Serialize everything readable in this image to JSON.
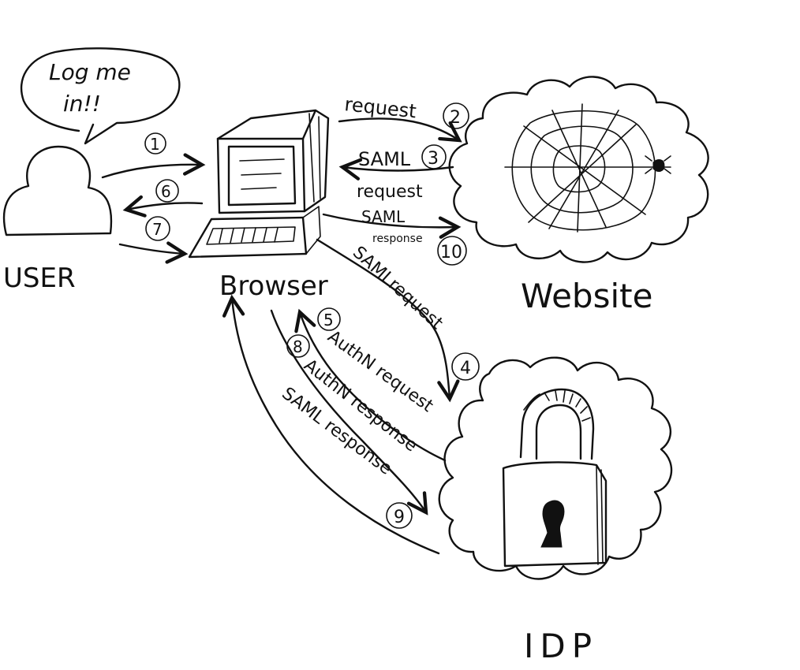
{
  "actors": {
    "user": {
      "label": "USER",
      "speech": [
        "Log me",
        "in!!"
      ]
    },
    "browser": {
      "label": "Browser"
    },
    "website": {
      "label": "Website"
    },
    "idp": {
      "label": "IDP"
    }
  },
  "flows": {
    "user_to_browser": {
      "step": "1"
    },
    "browser_to_user": {
      "step": "6"
    },
    "user_to_browser_2": {
      "step": "7"
    },
    "request": {
      "step": "2",
      "label": "request"
    },
    "saml_request": {
      "step": "3",
      "label_top": "SAML",
      "label_bottom": "request"
    },
    "saml_response_site": {
      "step": "10",
      "label_top": "SAML",
      "label_bottom": "response"
    },
    "saml_request_idp": {
      "step": "4",
      "label": "SAMLrequest"
    },
    "authn_request": {
      "step": "5",
      "label": "AuthN request"
    },
    "authn_response": {
      "step": "8",
      "label": "AuthN response"
    },
    "saml_response_idp": {
      "step": "9",
      "label": "SAML response"
    }
  },
  "icons": {
    "user": "person-icon",
    "browser": "computer-icon",
    "website": "spider-web-icon",
    "idp": "padlock-icon"
  }
}
